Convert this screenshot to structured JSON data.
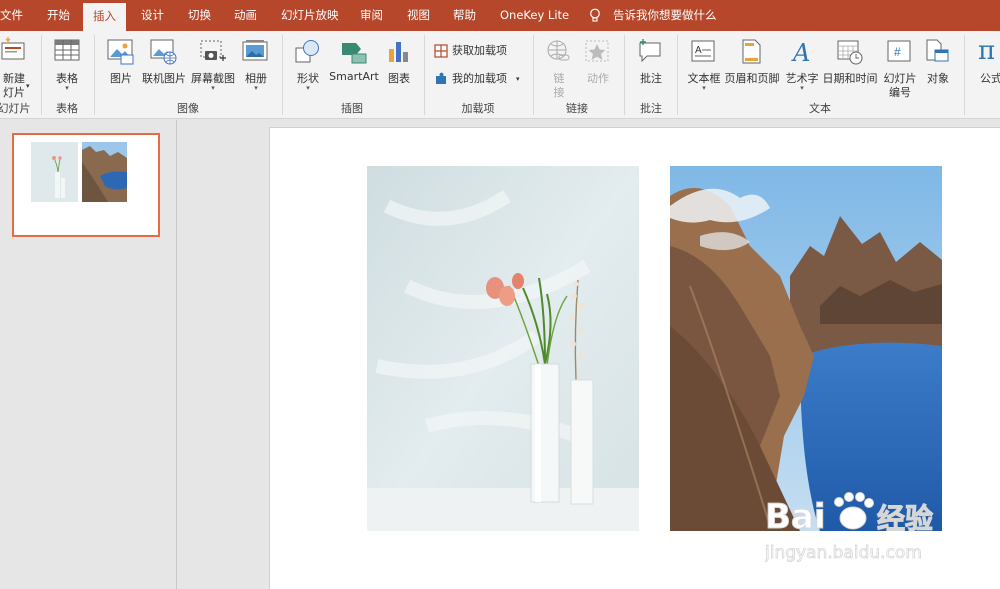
{
  "tabs": {
    "file": "文件",
    "home": "开始",
    "insert": "插入",
    "design": "设计",
    "transitions": "切换",
    "animations": "动画",
    "slideshow": "幻灯片放映",
    "review": "审阅",
    "view": "视图",
    "help": "帮助",
    "onekey": "OneKey Lite",
    "tellme": "告诉我你想要做什么"
  },
  "ribbon": {
    "slides": {
      "new_slide_line1": "新建",
      "new_slide_line2": "灯片",
      "group": "幻灯片"
    },
    "tables": {
      "table": "表格",
      "group": "表格"
    },
    "images": {
      "picture": "图片",
      "online_picture": "联机图片",
      "screenshot": "屏幕截图",
      "album": "相册",
      "group": "图像"
    },
    "illustrations": {
      "shapes": "形状",
      "smartart": "SmartArt",
      "chart": "图表",
      "group": "插图"
    },
    "addins": {
      "get_addins": "获取加载项",
      "my_addins": "我的加载项",
      "group": "加载项"
    },
    "links": {
      "link_line1": "链",
      "link_line2": "接",
      "action": "动作",
      "group": "链接"
    },
    "comments": {
      "comment": "批注",
      "group": "批注"
    },
    "text": {
      "textbox": "文本框",
      "header_footer": "页眉和页脚",
      "wordart": "艺术字",
      "datetime": "日期和时间",
      "slide_number_line1": "幻灯片",
      "slide_number_line2": "编号",
      "object": "对象",
      "group": "文本"
    },
    "symbols": {
      "equation": "公式"
    }
  },
  "slide": {
    "images": [
      "vase-with-flowers-photo",
      "mountain-lake-canyon-photo"
    ]
  },
  "watermark": {
    "brand": "Bai",
    "brand2": "经验",
    "url": "jingyan.baidu.com"
  },
  "colors": {
    "accent": "#b7472a",
    "selection": "#e56b44"
  }
}
